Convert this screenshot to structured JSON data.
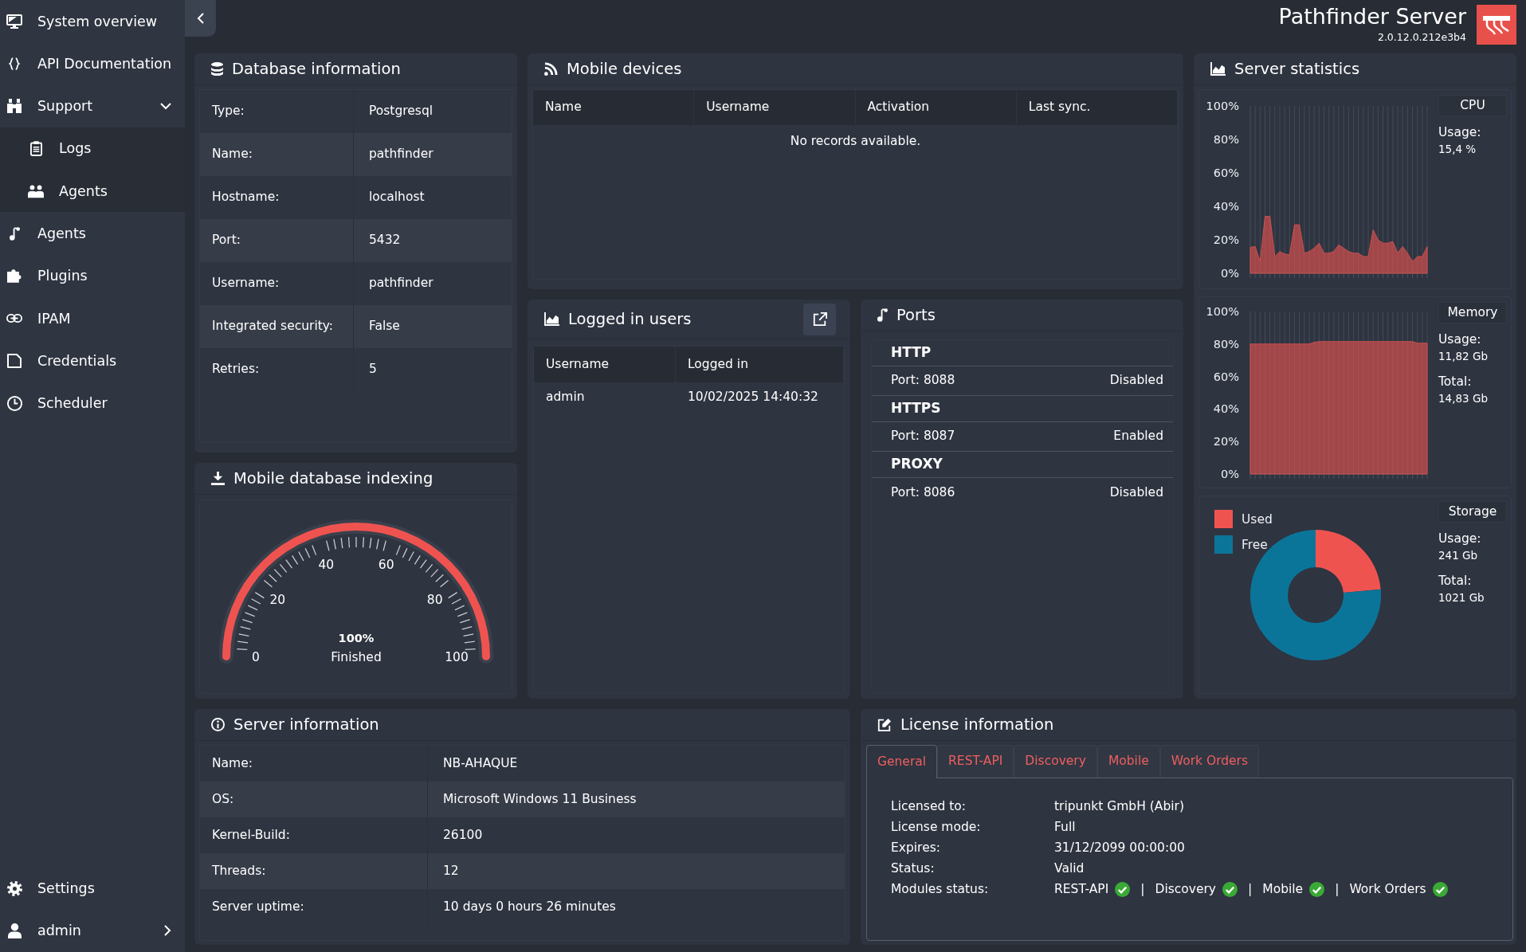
{
  "sidebar": {
    "items": [
      {
        "label": "System overview"
      },
      {
        "label": "API Documentation"
      },
      {
        "label": "Support",
        "expanded": true,
        "children": [
          {
            "label": "Logs"
          },
          {
            "label": "Agents"
          }
        ]
      },
      {
        "label": "Agents"
      },
      {
        "label": "Plugins"
      },
      {
        "label": "IPAM"
      },
      {
        "label": "Credentials"
      },
      {
        "label": "Scheduler"
      }
    ],
    "footer_items": [
      {
        "label": "Settings"
      },
      {
        "label": "admin",
        "expanded": false
      }
    ]
  },
  "header": {
    "title": "Pathfinder Server",
    "version": "2.0.12.0.212e3b4"
  },
  "database_information": {
    "title": "Database information",
    "rows": [
      {
        "label": "Type:",
        "value": "Postgresql"
      },
      {
        "label": "Name:",
        "value": "pathfinder"
      },
      {
        "label": "Hostname:",
        "value": "localhost"
      },
      {
        "label": "Port:",
        "value": "5432"
      },
      {
        "label": "Username:",
        "value": "pathfinder"
      },
      {
        "label": "Integrated security:",
        "value": "False"
      },
      {
        "label": "Retries:",
        "value": "5"
      }
    ]
  },
  "mobile_devices": {
    "title": "Mobile devices",
    "columns": [
      "Name",
      "Username",
      "Activation",
      "Last sync."
    ],
    "empty_text": "No records available."
  },
  "server_statistics": {
    "title": "Server statistics",
    "panels": [
      {
        "title": "CPU",
        "stats": [
          {
            "label": "Usage:",
            "value": "15,4 %"
          }
        ],
        "chart_data": {
          "type": "area",
          "grid": "x",
          "categories": [
            null,
            null,
            null,
            null,
            null,
            null,
            null,
            null,
            null,
            null,
            null,
            null,
            null,
            null,
            null,
            null,
            null,
            null,
            null,
            null,
            null,
            null,
            null,
            null,
            null,
            null,
            null,
            null,
            null,
            null,
            null,
            null,
            null,
            null,
            null,
            null,
            null
          ],
          "ylim": [
            0,
            100
          ],
          "yticks": [
            {
              "value": 0,
              "label": "0%"
            },
            {
              "value": 20,
              "label": "20%"
            },
            {
              "value": 40,
              "label": "40%"
            },
            {
              "value": 60,
              "label": "60%"
            },
            {
              "value": 80,
              "label": "80%"
            },
            {
              "value": 100,
              "label": "100%"
            }
          ],
          "values": [
            15.5,
            16,
            7,
            34,
            34,
            10,
            13,
            11.5,
            11,
            29,
            29,
            12,
            13,
            15,
            18,
            12,
            12,
            13,
            17,
            15,
            13,
            12,
            12,
            10,
            10,
            26,
            20,
            18,
            18,
            19,
            12,
            16,
            12,
            7,
            10,
            10,
            16
          ]
        }
      },
      {
        "title": "Memory",
        "stats": [
          {
            "label": "Usage:",
            "value": "11,82 Gb"
          },
          {
            "label": "Total:",
            "value": "14,83 Gb"
          }
        ],
        "chart_data": {
          "type": "area",
          "grid": "x",
          "categories": [
            null,
            null,
            null,
            null,
            null,
            null,
            null,
            null,
            null,
            null,
            null,
            null,
            null,
            null,
            null,
            null,
            null,
            null,
            null,
            null,
            null,
            null,
            null,
            null,
            null,
            null,
            null,
            null,
            null,
            null,
            null,
            null,
            null,
            null,
            null,
            null,
            null
          ],
          "ylim": [
            0,
            100
          ],
          "yticks": [
            {
              "value": 0,
              "label": "0%"
            },
            {
              "value": 20,
              "label": "20%"
            },
            {
              "value": 40,
              "label": "40%"
            },
            {
              "value": 60,
              "label": "60%"
            },
            {
              "value": 80,
              "label": "80%"
            },
            {
              "value": 100,
              "label": "100%"
            }
          ],
          "values": [
            80,
            80,
            80,
            80,
            80,
            80,
            80,
            80,
            80,
            80,
            80,
            80,
            80,
            81,
            81.5,
            81.5,
            81.5,
            81.5,
            81.5,
            81.5,
            81.5,
            81.5,
            81.5,
            81.5,
            81.5,
            81.5,
            81.5,
            81.5,
            81.5,
            81.5,
            81.5,
            81.5,
            81.5,
            81.5,
            80.5,
            80.5,
            80.5
          ]
        }
      },
      {
        "title": "Storage",
        "stats": [
          {
            "label": "Usage:",
            "value": "241 Gb"
          },
          {
            "label": "Total:",
            "value": "1021 Gb"
          }
        ],
        "chart_data": {
          "type": "donut",
          "categories": [
            "Used",
            "Free"
          ],
          "values": [
            23.6,
            76.4
          ],
          "colors": [
            "#ef5350",
            "#0b7599"
          ],
          "legend": "top-left"
        }
      }
    ]
  },
  "mobile_database_indexing": {
    "title": "Mobile database indexing",
    "gauge": {
      "level": 1,
      "reading": "100%",
      "status": "Finished",
      "scale": [
        "0",
        "20",
        "40",
        "60",
        "80",
        "100"
      ]
    }
  },
  "logged_in_users": {
    "title": "Logged in users",
    "columns": [
      "Username",
      "Logged in"
    ],
    "rows": [
      [
        "admin",
        "10/02/2025 14:40:32"
      ]
    ]
  },
  "ports": {
    "title": "Ports",
    "groups": [
      {
        "name": "HTTP",
        "port": "Port: 8088",
        "status": "Disabled"
      },
      {
        "name": "HTTPS",
        "port": "Port: 8087",
        "status": "Enabled"
      },
      {
        "name": "PROXY",
        "port": "Port: 8086",
        "status": "Disabled"
      }
    ]
  },
  "server_information": {
    "title": "Server information",
    "rows": [
      {
        "label": "Name:",
        "value": "NB-AHAQUE"
      },
      {
        "label": "OS:",
        "value": "Microsoft Windows 11 Business"
      },
      {
        "label": "Kernel-Build:",
        "value": "26100"
      },
      {
        "label": "Threads:",
        "value": "12"
      },
      {
        "label": "Server uptime:",
        "value": "10 days 0 hours 26 minutes"
      }
    ]
  },
  "license_information": {
    "title": "License information",
    "tabs": [
      {
        "label": "General",
        "selected": true
      },
      {
        "label": "REST-API",
        "selected": false
      },
      {
        "label": "Discovery",
        "selected": false
      },
      {
        "label": "Mobile",
        "selected": false
      },
      {
        "label": "Work Orders",
        "selected": false
      }
    ],
    "fields": [
      {
        "label": "Licensed to:",
        "value": "tripunkt GmbH (Abir)"
      },
      {
        "label": "License mode:",
        "value": "Full"
      },
      {
        "label": "Expires:",
        "value": "31/12/2099 00:00:00"
      },
      {
        "label": "Status:",
        "value": "Valid"
      }
    ],
    "modules_label": "Modules status:",
    "modules": [
      {
        "name": "REST-API",
        "ok": true
      },
      {
        "separator": "|",
        "name": "Discovery",
        "ok": true
      },
      {
        "separator": "|",
        "name": "Mobile",
        "ok": true
      },
      {
        "separator": "|",
        "name": "Work Orders",
        "ok": true
      }
    ]
  }
}
